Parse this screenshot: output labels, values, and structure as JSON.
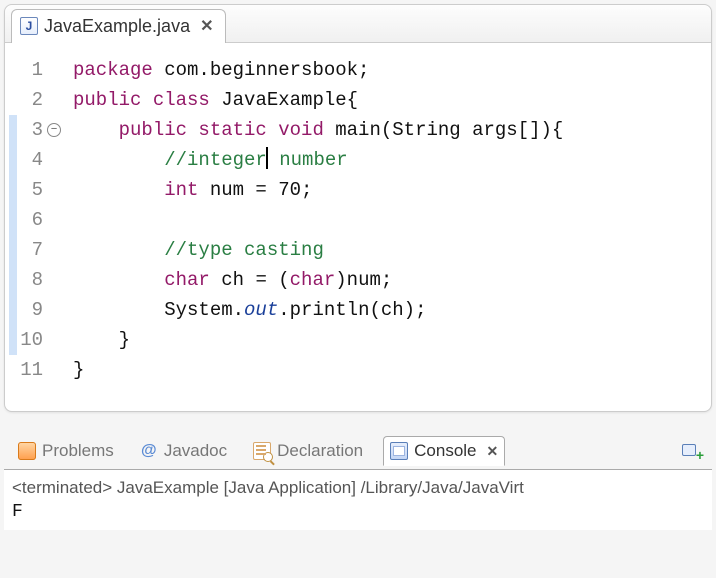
{
  "editor": {
    "tab": {
      "filename": "JavaExample.java",
      "file_icon_letter": "J"
    },
    "lines": [
      {
        "n": 1,
        "tokens": [
          {
            "t": "package ",
            "c": "kw"
          },
          {
            "t": "com.beginnersbook;",
            "c": "plain"
          }
        ]
      },
      {
        "n": 2,
        "tokens": [
          {
            "t": "public class ",
            "c": "kw"
          },
          {
            "t": "JavaExample{",
            "c": "plain"
          }
        ]
      },
      {
        "n": 3,
        "fold": true,
        "bluestrip": true,
        "tokens": [
          {
            "t": "    ",
            "c": "plain"
          },
          {
            "t": "public static void ",
            "c": "kw"
          },
          {
            "t": "main(String args[]){",
            "c": "plain"
          }
        ]
      },
      {
        "n": 4,
        "current": true,
        "bluestrip": true,
        "tokens": [
          {
            "t": "        ",
            "c": "plain"
          },
          {
            "t": "//integer",
            "c": "comment"
          },
          {
            "cursor": true
          },
          {
            "t": " number",
            "c": "comment"
          }
        ]
      },
      {
        "n": 5,
        "bluestrip": true,
        "tokens": [
          {
            "t": "        ",
            "c": "plain"
          },
          {
            "t": "int ",
            "c": "kw"
          },
          {
            "t": "num = 70;",
            "c": "plain"
          }
        ]
      },
      {
        "n": 6,
        "bluestrip": true,
        "tokens": [
          {
            "t": "",
            "c": "plain"
          }
        ]
      },
      {
        "n": 7,
        "bluestrip": true,
        "tokens": [
          {
            "t": "        ",
            "c": "plain"
          },
          {
            "t": "//type casting",
            "c": "comment"
          }
        ]
      },
      {
        "n": 8,
        "bluestrip": true,
        "tokens": [
          {
            "t": "        ",
            "c": "plain"
          },
          {
            "t": "char ",
            "c": "kw"
          },
          {
            "t": "ch = (",
            "c": "plain"
          },
          {
            "t": "char",
            "c": "kw"
          },
          {
            "t": ")num;",
            "c": "plain"
          }
        ]
      },
      {
        "n": 9,
        "bluestrip": true,
        "tokens": [
          {
            "t": "        System.",
            "c": "plain"
          },
          {
            "t": "out",
            "c": "static-it"
          },
          {
            "t": ".println(ch);",
            "c": "plain"
          }
        ]
      },
      {
        "n": 10,
        "bluestrip": true,
        "tokens": [
          {
            "t": "    }",
            "c": "plain"
          }
        ]
      },
      {
        "n": 11,
        "tokens": [
          {
            "t": "}",
            "c": "plain"
          }
        ]
      }
    ]
  },
  "views": {
    "problems": "Problems",
    "javadoc": "Javadoc",
    "declaration": "Declaration",
    "console": "Console"
  },
  "console": {
    "status": "<terminated> JavaExample [Java Application] /Library/Java/JavaVirt",
    "output": "F"
  }
}
